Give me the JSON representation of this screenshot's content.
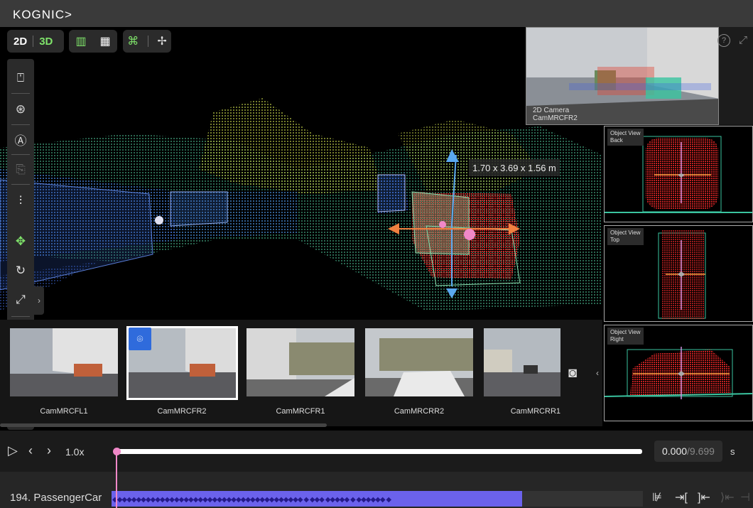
{
  "app": {
    "logo": "KOGNIC>"
  },
  "toolbar": {
    "mode_2d": "2D",
    "mode_3d": "3D",
    "layout_icons": [
      "layout-sidebar-icon",
      "layout-grid-icon"
    ],
    "tool_icons": [
      "command-icon",
      "crosshair-move-icon"
    ]
  },
  "left_tools": [
    "vehicle-box-icon",
    "steering-wheel-icon",
    "auto-annotate-icon",
    "document-tool-icon",
    "adjust-sliders-icon",
    "move-arrows-icon",
    "rotate-icon",
    "scale-icon",
    "rotate-90-icon",
    "move-point-icon",
    "move-point-plus-icon",
    "magnet-snap-icon"
  ],
  "viewport": {
    "dimensions": "1.70 x 3.69 x 1.56 m",
    "accent_color": "#7fe36a"
  },
  "camera_preview": {
    "title": "2D Camera",
    "camera": "CamMRCFR2"
  },
  "object_views": [
    {
      "title": "Object View",
      "view": "Back"
    },
    {
      "title": "Object View",
      "view": "Top"
    },
    {
      "title": "Object View",
      "view": "Right"
    }
  ],
  "cameras": [
    {
      "label": "CamMRCFL1",
      "selected": false
    },
    {
      "label": "CamMRCFR2",
      "selected": true
    },
    {
      "label": "CamMRCFR1",
      "selected": false
    },
    {
      "label": "CamMRCRR2",
      "selected": false
    },
    {
      "label": "CamMRCRR1",
      "selected": false
    }
  ],
  "playback": {
    "speed": "1.0x",
    "current_time": "0.000",
    "total_time": "/9.699",
    "unit": "s",
    "progress": 0.0
  },
  "timeline": {
    "object_label": "194. PassengerCar",
    "fill_color": "#6b62ec",
    "playhead_color": "#f088c8"
  }
}
